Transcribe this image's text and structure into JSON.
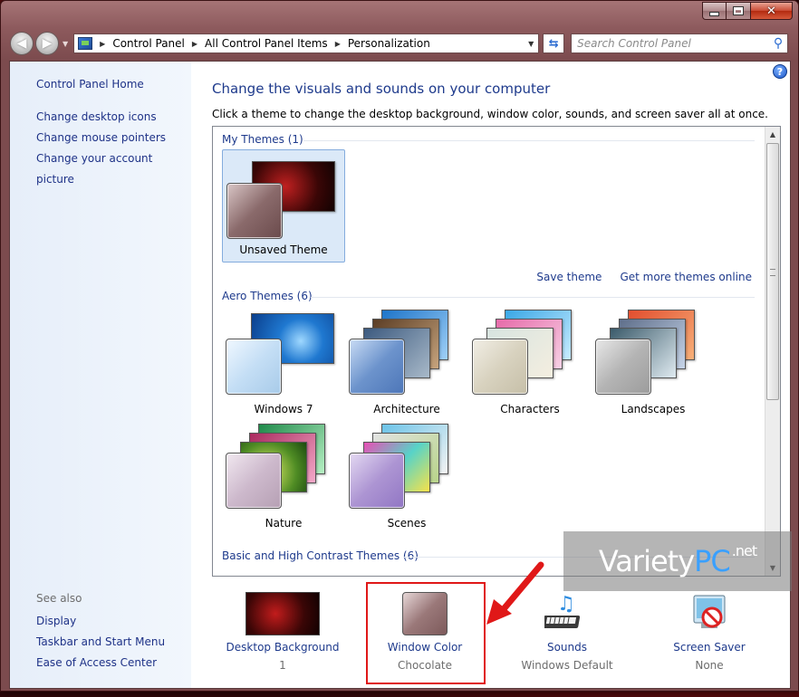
{
  "address": {
    "crumbs": [
      "Control Panel",
      "All Control Panel Items",
      "Personalization"
    ],
    "search_placeholder": "Search Control Panel"
  },
  "sidebar": {
    "home": "Control Panel Home",
    "links": [
      "Change desktop icons",
      "Change mouse pointers",
      "Change your account picture"
    ],
    "see_also_label": "See also",
    "see_also": [
      "Display",
      "Taskbar and Start Menu",
      "Ease of Access Center"
    ]
  },
  "main": {
    "title": "Change the visuals and sounds on your computer",
    "subtitle": "Click a theme to change the desktop background, window color, sounds, and screen saver all at once."
  },
  "groups": {
    "my_themes": "My Themes (1)",
    "aero_themes": "Aero Themes (6)",
    "basic_themes": "Basic and High Contrast Themes (6)"
  },
  "themes": {
    "my": [
      {
        "label": "Unsaved Theme"
      }
    ],
    "aero": [
      {
        "label": "Windows 7"
      },
      {
        "label": "Architecture"
      },
      {
        "label": "Characters"
      },
      {
        "label": "Landscapes"
      },
      {
        "label": "Nature"
      },
      {
        "label": "Scenes"
      }
    ]
  },
  "theme_links": {
    "save": "Save theme",
    "more": "Get more themes online"
  },
  "bottom": [
    {
      "label": "Desktop Background",
      "value": "1"
    },
    {
      "label": "Window Color",
      "value": "Chocolate"
    },
    {
      "label": "Sounds",
      "value": "Windows Default"
    },
    {
      "label": "Screen Saver",
      "value": "None"
    }
  ],
  "watermark": {
    "variety": "Variety",
    "pc": "PC",
    "net": ".net"
  },
  "colors": {
    "link": "#1e3a8c",
    "highlight": "#e01818",
    "window_frame": "#8d5a5d"
  }
}
